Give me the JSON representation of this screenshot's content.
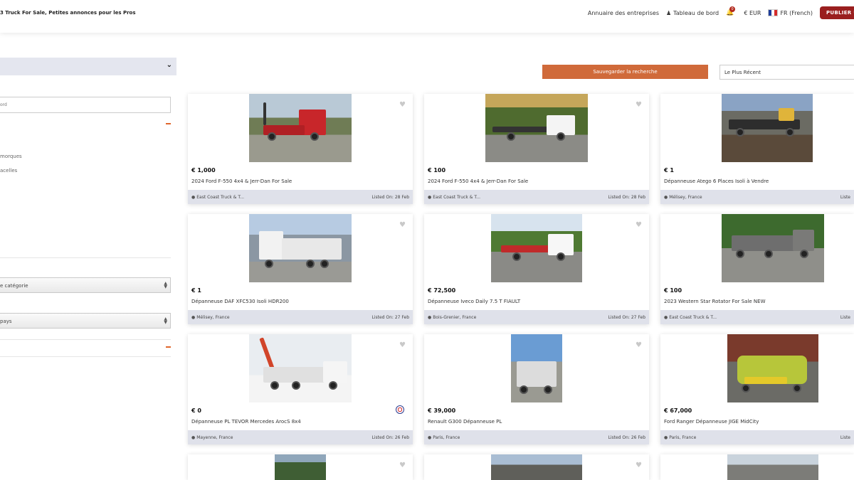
{
  "header": {
    "site_title": "3 Truck For Sale, Petites annonces pour les Pros",
    "nav": {
      "directory": "Annuaire des entreprises",
      "dashboard": "Tableau de bord",
      "notification_count": "0",
      "currency": "€ EUR",
      "language": "FR (French)",
      "publish": "PUBLIER U"
    }
  },
  "sidebar": {
    "keyword_placeholder": "ord",
    "category_items": [
      "morques",
      "acelles"
    ],
    "category_select": "e catégorie",
    "country_select": "pays"
  },
  "toolbar": {
    "save_search": "Sauvegarder la recherche",
    "sort": "Le Plus Récent"
  },
  "listings": [
    {
      "price": "€  1,000",
      "title": "2024 Ford F-550 4x4 & Jerr-Dan For Sale",
      "location": "East Coast Truck & T...",
      "listed": "Listed On: 28 Feb"
    },
    {
      "price": "€  100",
      "title": "2024 Ford F-550 4x4 & Jerr-Dan For Sale",
      "location": "East Coast Truck & T...",
      "listed": "Listed On: 28 Feb"
    },
    {
      "price": "€  1",
      "title": "Dépanneuse Atego 6 Places Isoli à Vendre",
      "location": "Mélisey, France",
      "listed": "Liste"
    },
    {
      "price": "€  1",
      "title": "Dépanneuse DAF XFC530 Isoli HDR200",
      "location": "Mélisey, France",
      "listed": "Listed On: 27 Feb"
    },
    {
      "price": "€  72,500",
      "title": "Dépanneuse Iveco Daily 7.5 T FIAULT",
      "location": "Bois-Grenier, France",
      "listed": "Listed On: 27 Feb"
    },
    {
      "price": "€  100",
      "title": "2023 Western Star Rotator For Sale NEW",
      "location": "East Coast Truck & T...",
      "listed": "Liste"
    },
    {
      "price": "€  0",
      "title": "Dépanneuse PL TEVOR Mercedes ArocS 8x4",
      "location": "Mayenne, France",
      "listed": "Listed On: 26 Feb"
    },
    {
      "price": "€  39,000",
      "title": "Renault G300 Dépanneuse PL",
      "location": "Paris, France",
      "listed": "Listed On: 26 Feb"
    },
    {
      "price": "€  67,000",
      "title": "Ford Ranger Dépanneuse JIGE MidCity",
      "location": "Paris, France",
      "listed": "Liste"
    }
  ]
}
